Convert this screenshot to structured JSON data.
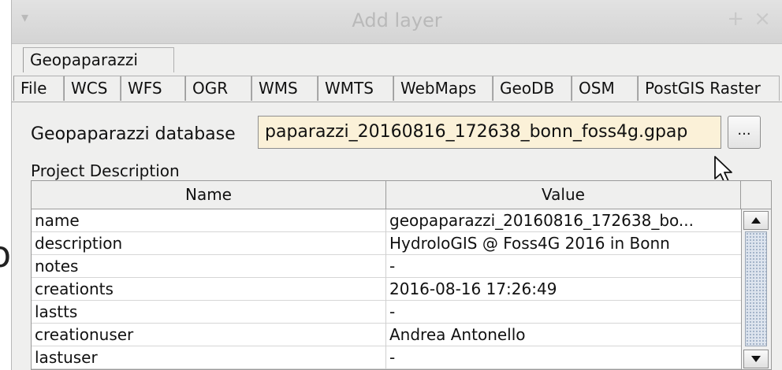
{
  "window": {
    "title": "Add layer"
  },
  "tabs_row1": [
    "Geopaparazzi"
  ],
  "tabs_row2": [
    "File",
    "WCS",
    "WFS",
    "OGR",
    "WMS",
    "WMTS",
    "WebMaps",
    "GeoDB",
    "OSM",
    "PostGIS Raster"
  ],
  "form": {
    "db_label": "Geopaparazzi database",
    "db_value": "paparazzi_20160816_172638_bonn_foss4g.gpap",
    "browse_label": "...",
    "project_label": "Project Description"
  },
  "table": {
    "col_name": "Name",
    "col_value": "Value",
    "rows": [
      {
        "name": "name",
        "value": "geopaparazzi_20160816_172638_bo..."
      },
      {
        "name": "description",
        "value": "HydroloGIS @ Foss4G 2016 in Bonn"
      },
      {
        "name": "notes",
        "value": "-"
      },
      {
        "name": "creationts",
        "value": "2016-08-16 17:26:49"
      },
      {
        "name": "lastts",
        "value": "-"
      },
      {
        "name": "creationuser",
        "value": "Andrea Antonello"
      },
      {
        "name": "lastuser",
        "value": "-"
      }
    ]
  },
  "stray_text": "o",
  "icons": {
    "menu": "window-menu-icon",
    "plus": "maximize-icon",
    "close": "close-icon",
    "cursor": "mouse-pointer-icon"
  },
  "colors": {
    "input_bg": "#fbf1d8",
    "scroll_thumb": "#dde4ee"
  }
}
